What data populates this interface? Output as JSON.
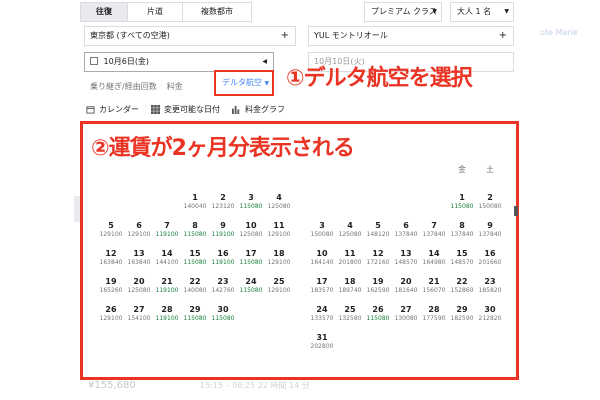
{
  "tabs": [
    "往復",
    "片道",
    "複数都市"
  ],
  "cabin": "プレミアム クラス",
  "passengers": "大人 1 名",
  "bg_text": "ote Marie",
  "origin": "東京都 (すべての空港)",
  "destination": "YUL モントリオール",
  "depart_date": "10月6日(金)",
  "return_date": "10月10日(火)",
  "filters": [
    "乗り継ぎ/経由回数",
    "料金"
  ],
  "airline_filter": "デルタ航空",
  "annotation1": "①デルタ航空を選択",
  "tools": [
    "カレンダー",
    "変更可能な日付",
    "料金グラフ"
  ],
  "annotation2": "②運賃が2ヶ月分表示される",
  "weekdays": {
    "fri": "金",
    "sat": "土"
  },
  "bottom_price": "¥155,680",
  "bottom_mid": "15:15 – 08:25   22 時間 14 分",
  "month1": [
    {
      "d": "1",
      "p": "140040"
    },
    {
      "d": "2",
      "p": "123120"
    },
    {
      "d": "3",
      "p": "115080",
      "low": true
    },
    {
      "d": "4",
      "p": "125080"
    },
    {
      "d": "5",
      "p": "129100"
    },
    {
      "d": "6",
      "p": "129100"
    },
    {
      "d": "7",
      "p": "119100",
      "low": true
    },
    {
      "d": "8",
      "p": "115080",
      "low": true
    },
    {
      "d": "9",
      "p": "119100",
      "low": true
    },
    {
      "d": "10",
      "p": "125080"
    },
    {
      "d": "11",
      "p": "129100"
    },
    {
      "d": "12",
      "p": "163840"
    },
    {
      "d": "13",
      "p": "163840"
    },
    {
      "d": "14",
      "p": "144100"
    },
    {
      "d": "15",
      "p": "115080",
      "low": true
    },
    {
      "d": "16",
      "p": "119100",
      "low": true
    },
    {
      "d": "17",
      "p": "115080",
      "low": true
    },
    {
      "d": "18",
      "p": "129100"
    },
    {
      "d": "19",
      "p": "165260"
    },
    {
      "d": "20",
      "p": "125080"
    },
    {
      "d": "21",
      "p": "119100",
      "low": true
    },
    {
      "d": "22",
      "p": "140080"
    },
    {
      "d": "23",
      "p": "142760"
    },
    {
      "d": "24",
      "p": "115080",
      "low": true
    },
    {
      "d": "25",
      "p": "129100"
    },
    {
      "d": "26",
      "p": "129100"
    },
    {
      "d": "27",
      "p": "154100"
    },
    {
      "d": "28",
      "p": "119100",
      "low": true
    },
    {
      "d": "29",
      "p": "115080",
      "low": true
    },
    {
      "d": "30",
      "p": "115080",
      "low": true
    }
  ],
  "month2": [
    {
      "d": "1",
      "p": "115080",
      "low": true
    },
    {
      "d": "2",
      "p": "150080"
    },
    {
      "d": "3",
      "p": "150080"
    },
    {
      "d": "4",
      "p": "125080"
    },
    {
      "d": "5",
      "p": "148120"
    },
    {
      "d": "6",
      "p": "137840"
    },
    {
      "d": "7",
      "p": "137840"
    },
    {
      "d": "8",
      "p": "137840"
    },
    {
      "d": "9",
      "p": "137840"
    },
    {
      "d": "10",
      "p": "164140"
    },
    {
      "d": "11",
      "p": "201800"
    },
    {
      "d": "12",
      "p": "172160"
    },
    {
      "d": "13",
      "p": "148570"
    },
    {
      "d": "14",
      "p": "164980"
    },
    {
      "d": "15",
      "p": "148570"
    },
    {
      "d": "16",
      "p": "201660"
    },
    {
      "d": "17",
      "p": "183570"
    },
    {
      "d": "18",
      "p": "189740"
    },
    {
      "d": "19",
      "p": "162590"
    },
    {
      "d": "20",
      "p": "181640"
    },
    {
      "d": "21",
      "p": "156070"
    },
    {
      "d": "22",
      "p": "152860"
    },
    {
      "d": "23",
      "p": "185820"
    },
    {
      "d": "24",
      "p": "133570"
    },
    {
      "d": "25",
      "p": "132580"
    },
    {
      "d": "26",
      "p": "115080",
      "low": true
    },
    {
      "d": "27",
      "p": "130080"
    },
    {
      "d": "28",
      "p": "177590"
    },
    {
      "d": "29",
      "p": "182590"
    },
    {
      "d": "30",
      "p": "212820"
    },
    {
      "d": "31",
      "p": "202800"
    }
  ]
}
